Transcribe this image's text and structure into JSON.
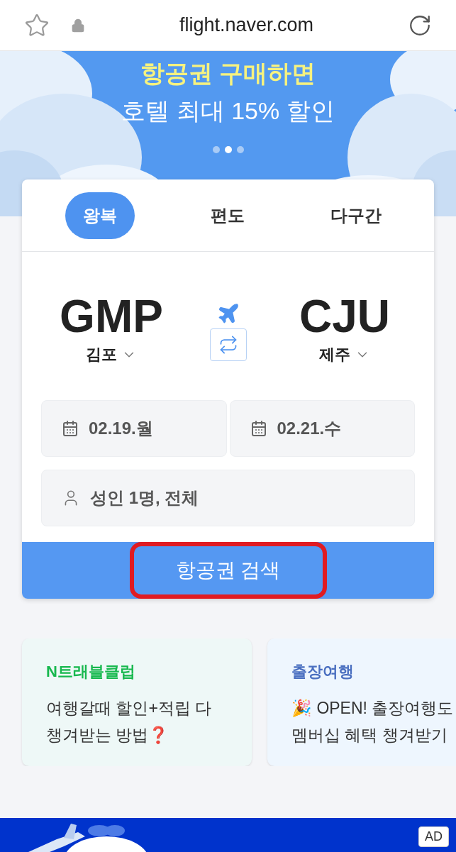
{
  "address_bar": {
    "url": "flight.naver.com"
  },
  "banner": {
    "headline": "항공권 구매하면",
    "subline": "호텔 최대 15% 할인",
    "dots": [
      {
        "selected": false
      },
      {
        "selected": true
      },
      {
        "selected": false
      }
    ]
  },
  "trip_tabs": [
    {
      "label": "왕복",
      "selected": true
    },
    {
      "label": "편도",
      "selected": false
    },
    {
      "label": "다구간",
      "selected": false
    }
  ],
  "route": {
    "origin": {
      "code": "GMP",
      "city": "김포"
    },
    "destination": {
      "code": "CJU",
      "city": "제주"
    }
  },
  "dates": [
    "02.19.월",
    "02.21.수"
  ],
  "passengers": "성인 1명, 전체",
  "search_button": {
    "label": "항공권 검색",
    "highlighted": true
  },
  "promo_cards": [
    {
      "title": "N트래블클럽",
      "lines": [
        "여행갈때 할인+적립 다",
        "챙겨받는 방법❓"
      ],
      "color": "#17b84e"
    },
    {
      "title": "출장여행",
      "lines": [
        "🎉 OPEN! 출장여행도",
        "멤버십 혜택 챙겨받기"
      ],
      "color": "#4a6fc0"
    }
  ],
  "ad": {
    "badge": "AD"
  }
}
